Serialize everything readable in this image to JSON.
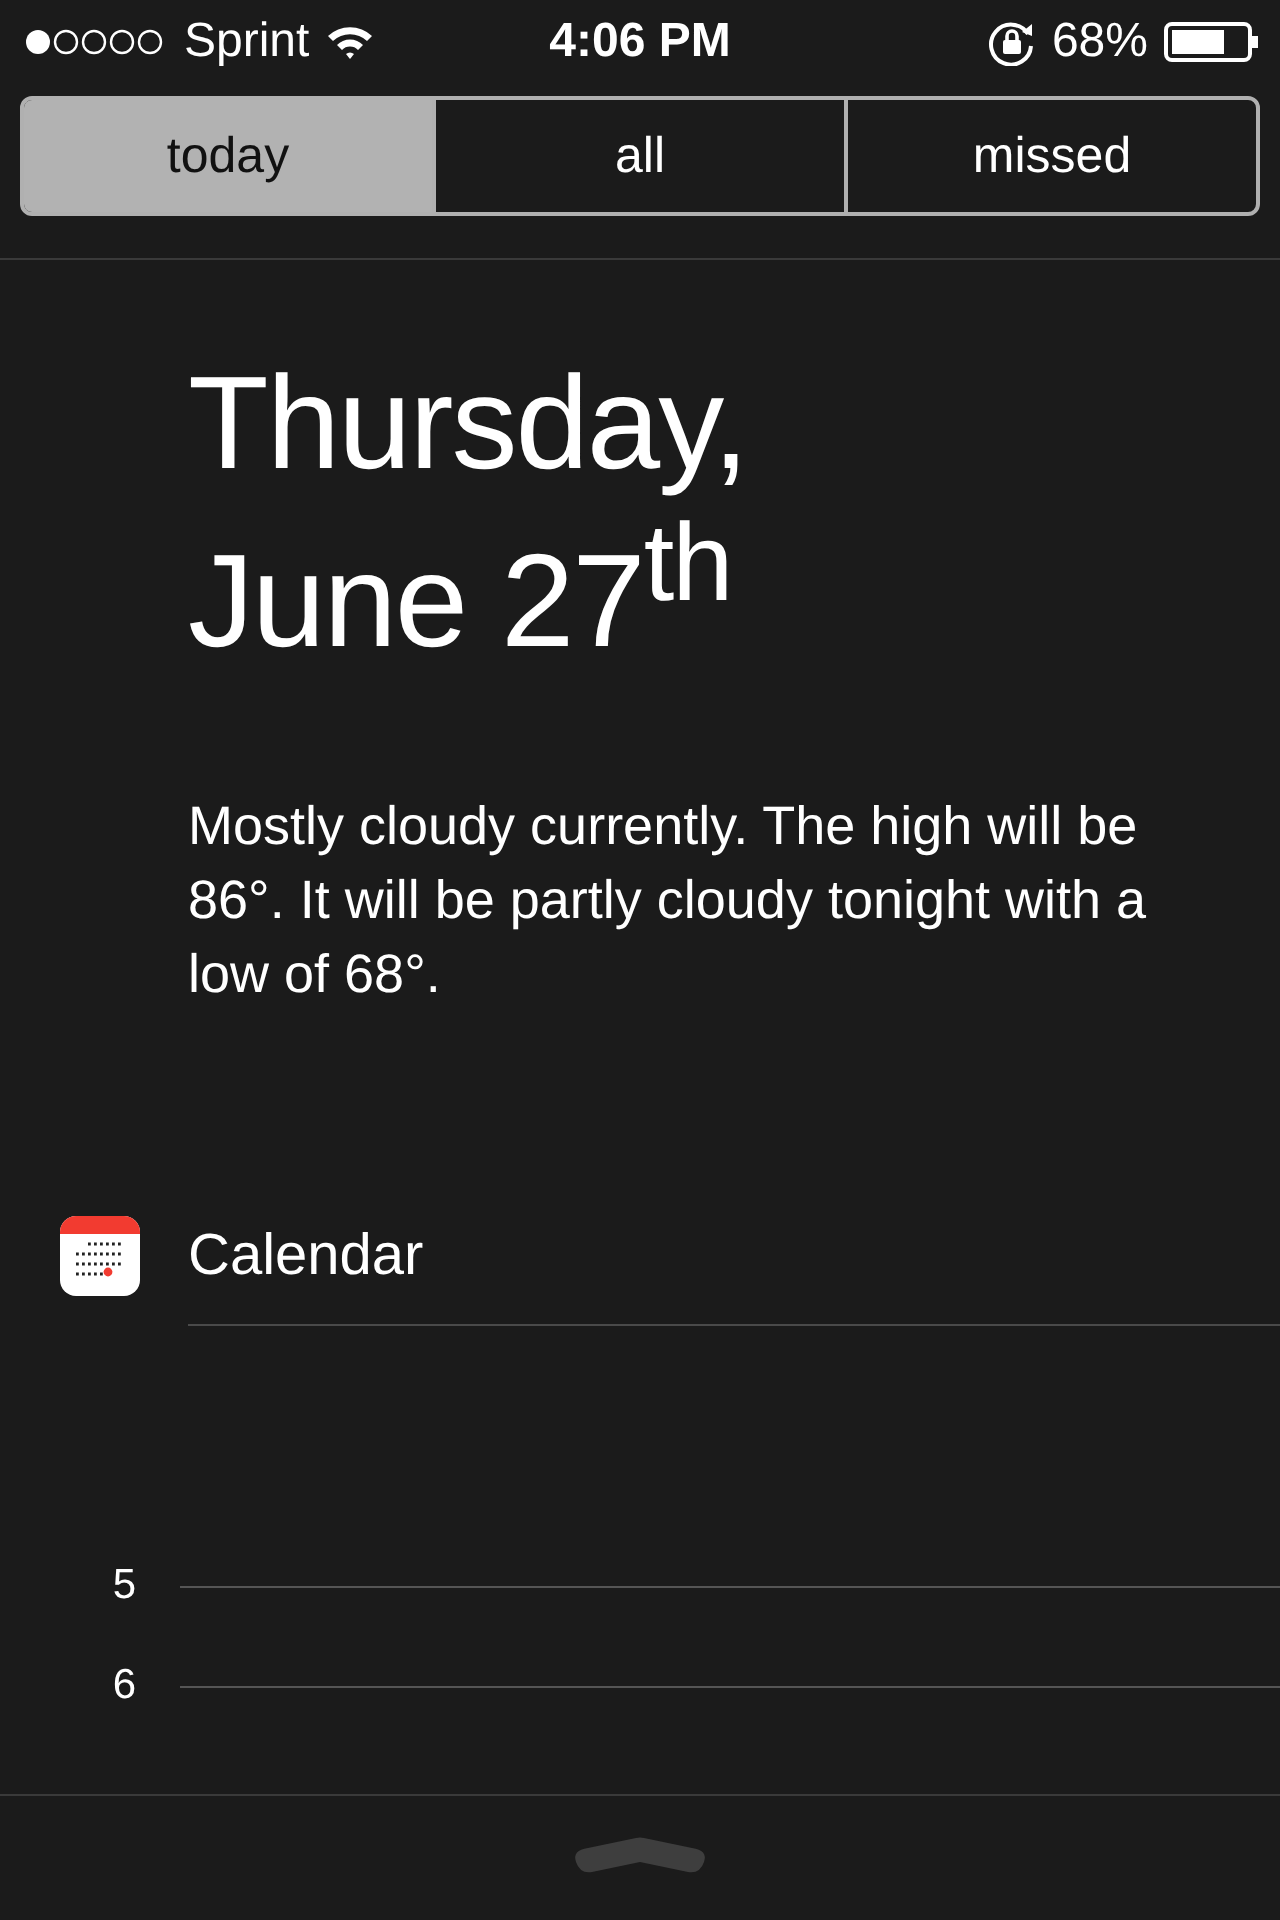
{
  "status_bar": {
    "carrier": "Sprint",
    "time": "4:06 PM",
    "battery": "68%"
  },
  "tabs": [
    {
      "label": "today",
      "selected": true
    },
    {
      "label": "all",
      "selected": false
    },
    {
      "label": "missed",
      "selected": false
    }
  ],
  "date": {
    "weekday": "Thursday,",
    "day": "June 27$^{th}$"
  },
  "weather": "Mostly cloudy currently. The high will be 86°. It will be partly cloudy tonight with a low of 68°.",
  "calendar": {
    "title": "Calendar",
    "hours": [
      "5",
      "6"
    ]
  }
}
